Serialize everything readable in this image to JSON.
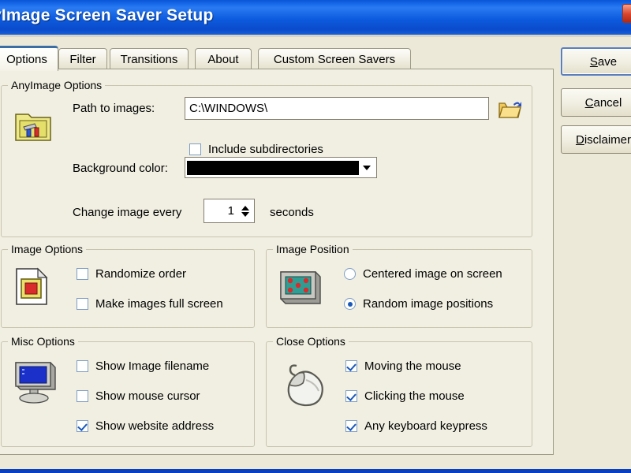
{
  "window": {
    "title": "AnyImage Screen Saver Setup",
    "title_visible": "yImage Screen Saver Setup",
    "close_label": "x",
    "titlebar_color": "#0A55D6",
    "body_color": "#ECE9D8"
  },
  "tabs": [
    {
      "label": "Options",
      "selected": true
    },
    {
      "label": "Filter",
      "selected": false
    },
    {
      "label": "Transitions",
      "selected": false
    },
    {
      "label": "About",
      "selected": false
    },
    {
      "label": "Custom Screen Savers",
      "selected": false
    }
  ],
  "groups": {
    "anyimage": {
      "title": "AnyImage Options",
      "path_label": "Path to images:",
      "path_value": "C:\\WINDOWS\\",
      "browse_icon": "open-folder-icon",
      "folder_tools_icon": "folder-tools-icon",
      "include_sub": {
        "label": "Include subdirectories",
        "checked": false
      },
      "bgcolor_label": "Background color:",
      "bgcolor_value": "#000000",
      "interval_label": "Change image every",
      "interval_value": "1",
      "interval_unit": "seconds"
    },
    "image_options": {
      "title": "Image Options",
      "icon": "image-document-icon",
      "items": [
        {
          "label": "Randomize order",
          "checked": false
        },
        {
          "label": "Make images full screen",
          "checked": false
        }
      ]
    },
    "image_position": {
      "title": "Image Position",
      "icon": "monitor-pattern-icon",
      "items": [
        {
          "label": "Centered image on screen",
          "selected": false
        },
        {
          "label": "Random image positions",
          "selected": true
        }
      ]
    },
    "misc_options": {
      "title": "Misc Options",
      "icon": "crt-monitor-icon",
      "items": [
        {
          "label": "Show Image filename",
          "checked": false
        },
        {
          "label": "Show mouse cursor",
          "checked": false
        },
        {
          "label": "Show website address",
          "checked": true
        }
      ]
    },
    "close_options": {
      "title": "Close Options",
      "icon": "mouse-icon",
      "items": [
        {
          "label": "Moving the mouse",
          "checked": true
        },
        {
          "label": "Clicking the mouse",
          "checked": true
        },
        {
          "label": "Any keyboard keypress",
          "checked": true
        }
      ]
    }
  },
  "buttons": [
    {
      "accel": "S",
      "rest": "ave",
      "name": "save-button",
      "focused": true
    },
    {
      "accel": "C",
      "rest": "ancel",
      "name": "cancel-button",
      "focused": false
    },
    {
      "accel": "D",
      "rest": "isclaimer",
      "name": "disclaimer-button",
      "focused": false
    }
  ]
}
